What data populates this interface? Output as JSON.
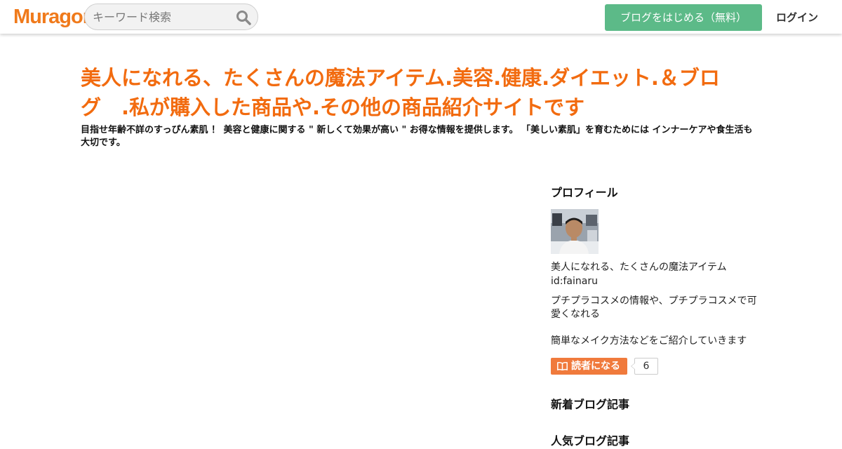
{
  "header": {
    "logo_text": "Muragon",
    "search_placeholder": "キーワード検索",
    "start_blog_label": "ブログをはじめる（無料）",
    "login_label": "ログイン"
  },
  "blog": {
    "title": "美人になれる、たくさんの魔法アイテム.美容.健康.ダイエット.＆ブログ　.私が購入した商品や.その他の商品紹介サイトです",
    "description": "目指せ年齢不詳のすっぴん素肌 ！ 美容と健康に関する \" 新しくて効果が高い \" お得な情報を提供します。 「美しい素肌」を育むためには インナーケアや食生活も大切です。"
  },
  "sidebar": {
    "profile_heading": "プロフィール",
    "profile_name": "美人になれる、たくさんの魔法アイテム",
    "profile_id": "id:fainaru",
    "profile_desc_1": "プチプラコスメの情報や、プチプラコスメで可愛くなれる",
    "profile_desc_2": "簡単なメイク方法などをご紹介していきます",
    "reader_button_label": "読者になる",
    "reader_count": "6",
    "new_posts_heading": "新着ブログ記事",
    "popular_posts_heading": "人気ブログ記事"
  },
  "colors": {
    "brand_orange": "#f07a1b",
    "title_orange": "#f26b0f",
    "start_button_green": "#5cba88",
    "reader_button_orange": "#f07a3c"
  }
}
